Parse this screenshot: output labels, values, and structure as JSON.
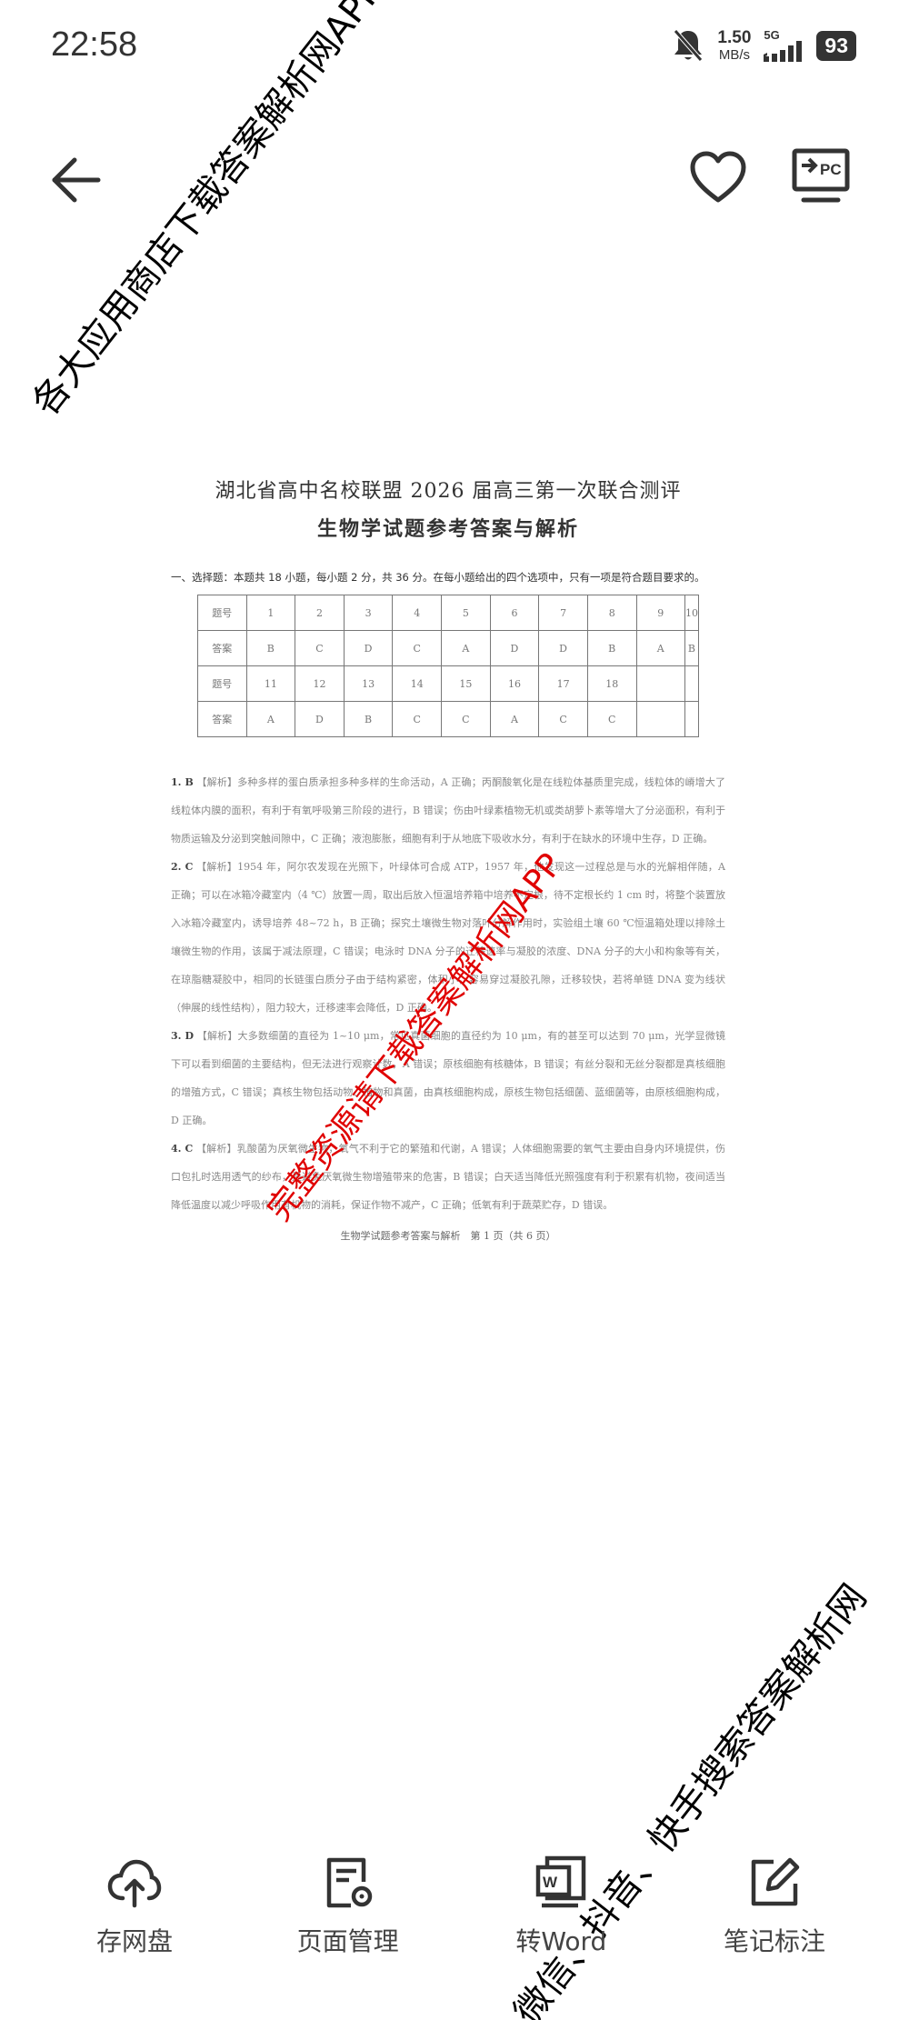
{
  "status_bar": {
    "time": "22:58",
    "net_speed_value": "1.50",
    "net_speed_unit": "MB/s",
    "network_type": "5G",
    "battery": "93",
    "icons": [
      "bell-muted-icon",
      "signal-icon",
      "battery-icon"
    ]
  },
  "top_nav": {
    "icons": [
      "back-arrow-icon",
      "heart-icon",
      "cast-pc-icon"
    ],
    "pc_label": "PC"
  },
  "document": {
    "title_line1": "湖北省高中名校联盟 2026 届高三第一次联合测评",
    "title_line2": "生物学试题参考答案与解析",
    "section_heading": "一、选择题：本题共 18 小题，每小题 2 分，共 36 分。在每小题给出的四个选项中，只有一项是符合题目要求的。",
    "answer_table": [
      [
        "题号",
        "1",
        "2",
        "3",
        "4",
        "5",
        "6",
        "7",
        "8",
        "9",
        "10"
      ],
      [
        "答案",
        "B",
        "C",
        "D",
        "C",
        "A",
        "D",
        "D",
        "B",
        "A",
        "B"
      ],
      [
        "题号",
        "11",
        "12",
        "13",
        "14",
        "15",
        "16",
        "17",
        "18",
        "",
        ""
      ],
      [
        "答案",
        "A",
        "D",
        "B",
        "C",
        "C",
        "A",
        "C",
        "C",
        "",
        ""
      ]
    ],
    "explanations": [
      {
        "num": "1. B",
        "text": "【解析】多种多样的蛋白质承担多种多样的生命活动，A 正确；丙酮酸氧化是在线粒体基质里完成，线粒体的嵴增大了线粒体内膜的面积，有利于有氧呼吸第三阶段的进行，B 错误；伤由叶绿素植物无机或类胡萝卜素等增大了分泌面积，有利于物质运输及分泌到突触间隙中，C 正确；液泡膨胀，细胞有利于从地底下吸收水分，有利于在缺水的环境中生存，D 正确。"
      },
      {
        "num": "2. C",
        "text": "【解析】1954 年，阿尔农发现在光照下，叶绿体可合成 ATP，1957 年，他发现这一过程总是与水的光解相伴随，A 正确；可以在冰箱冷藏室内（4 ℃）放置一周，取出后放入恒温培养箱中培养不定根，待不定根长约 1 cm 时，将整个装置放入冰箱冷藏室内，诱导培养 48~72 h，B 正确；探究土壤微生物对落叶分解作用时，实验组土壤 60 ℃恒温箱处理以排除土壤微生物的作用，该属于减法原理，C 错误；电泳时 DNA 分子的迁移速率与凝胶的浓度、DNA 分子的大小和构象等有关，在琼脂糖凝胶中，相同的长链蛋白质分子由于结构紧密，体积小，容易穿过凝胶孔隙，迁移较快，若将单链 DNA 变为线状（伸展的线性结构），阻力较大，迁移速率会降低，D 正确。"
      },
      {
        "num": "3. D",
        "text": "【解析】大多数细菌的直径为 1~10 μm，常见真菌细胞的直径约为 10 μm，有的甚至可以达到 70 μm，光学显微镜下可以看到细菌的主要结构，但无法进行观察计数，A 错误；原核细胞有核糖体，B 错误；有丝分裂和无丝分裂都是真核细胞的增殖方式，C 错误；真核生物包括动物、植物和真菌，由真核细胞构成，原核生物包括细菌、蓝细菌等，由原核细胞构成，D 正确。"
      },
      {
        "num": "4. C",
        "text": "【解析】乳酸菌为厌氧微生物，氧气不利于它的繁殖和代谢，A 错误；人体细胞需要的氧气主要由自身内环境提供，伤口包扎时选用透气的纱布，是避免厌氧微生物增殖带来的危害，B 错误；白天适当降低光照强度有利于积累有机物，夜间适当降低温度以减少呼吸作用有机物的消耗，保证作物不减产，C 正确；低氧有利于蔬菜贮存，D 错误。"
      }
    ],
    "footer": "生物学试题参考答案与解析　第 1 页（共 6 页）"
  },
  "watermarks": {
    "top_left": "各大应用商店下载答案解析网APP",
    "center_red": "完整资源请下载答案解析网APP",
    "bottom_right": "微信、抖音、快手搜索答案解析网"
  },
  "toolbar": {
    "items": [
      {
        "label": "存网盘",
        "icon": "cloud-upload-icon"
      },
      {
        "label": "页面管理",
        "icon": "page-settings-icon"
      },
      {
        "label": "转Word",
        "icon": "word-convert-icon"
      },
      {
        "label": "笔记标注",
        "icon": "edit-note-icon"
      }
    ]
  }
}
